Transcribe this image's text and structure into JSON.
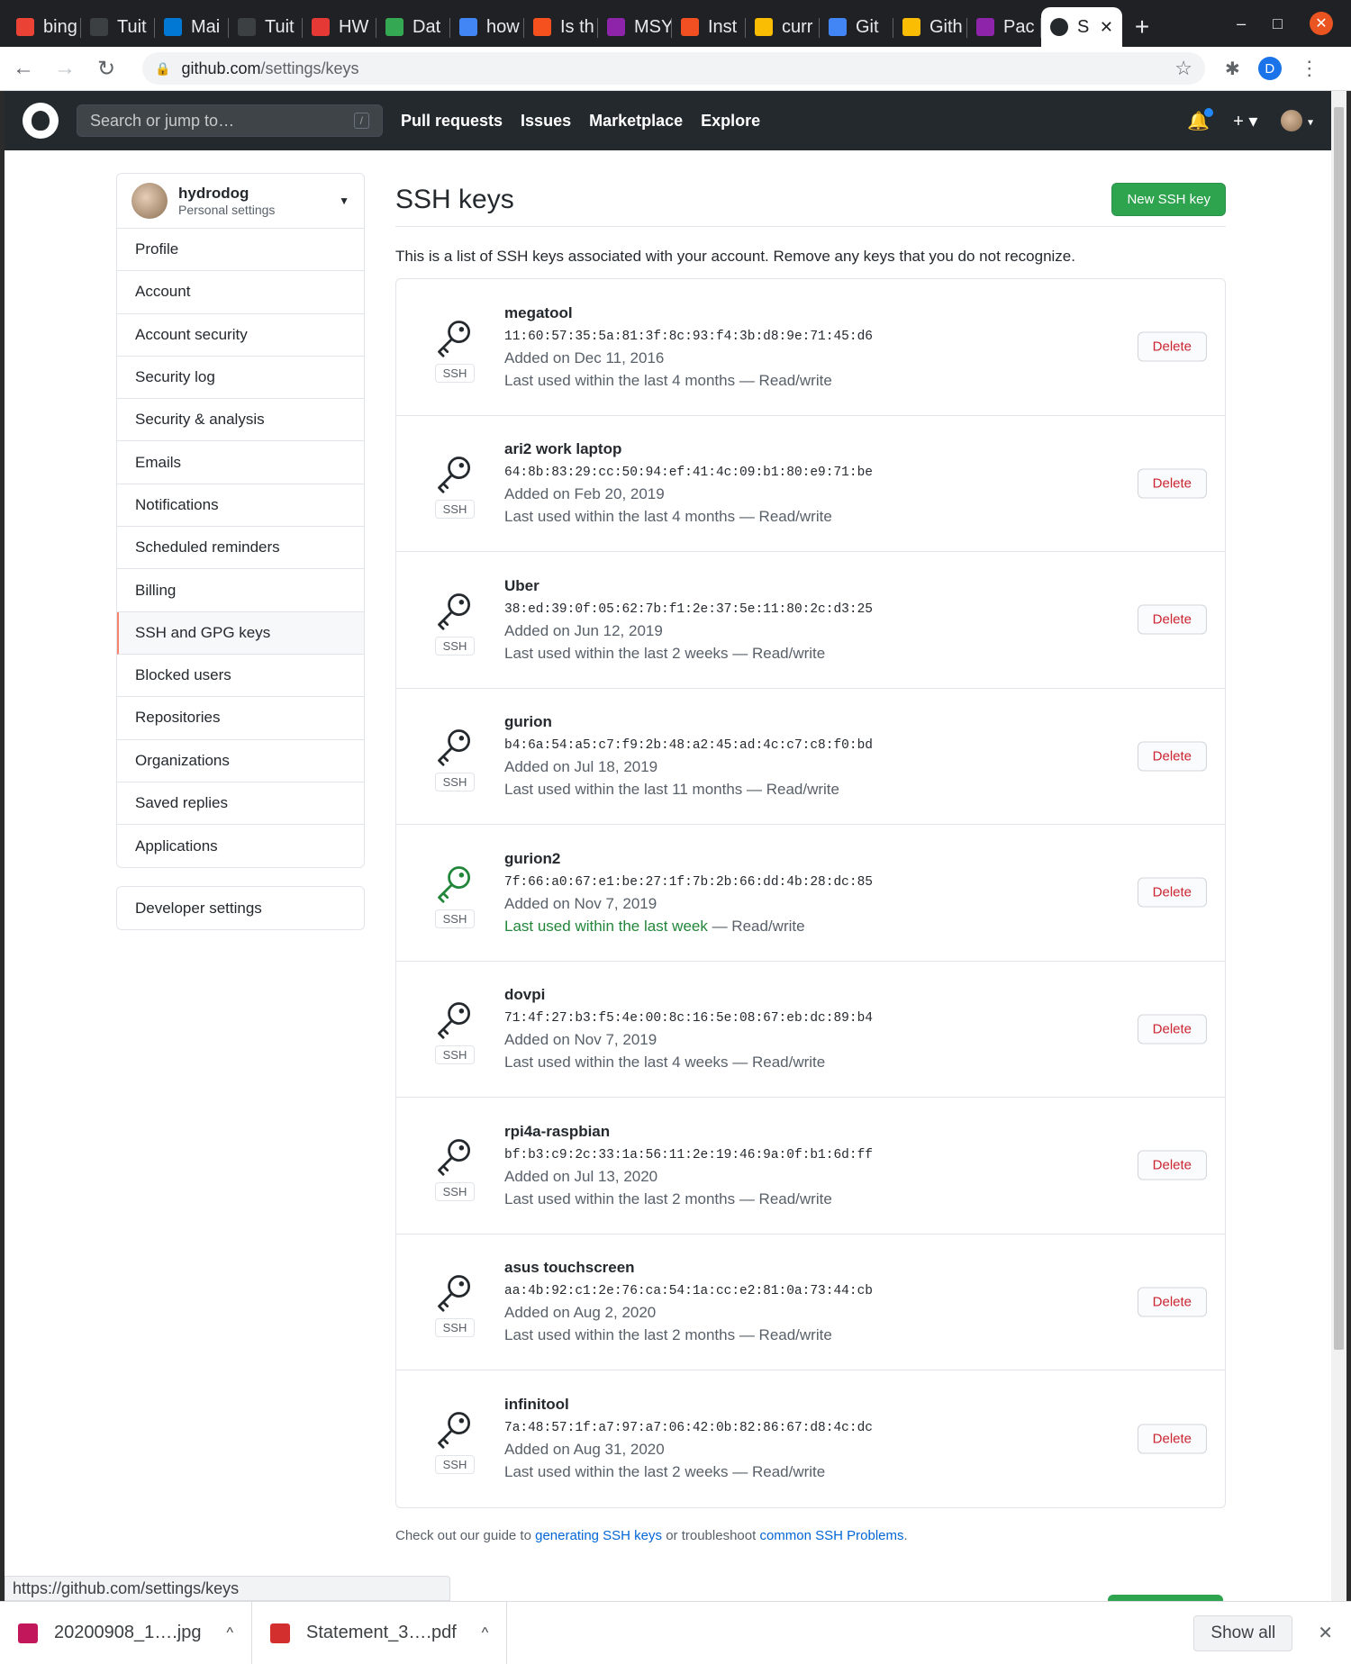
{
  "browser": {
    "tabs": [
      {
        "label": "bing",
        "color": "#ea4335"
      },
      {
        "label": "Tuit",
        "color": "#3c4043"
      },
      {
        "label": "Mai",
        "color": "#0078d4"
      },
      {
        "label": "Tuit",
        "color": "#3c4043"
      },
      {
        "label": "HW",
        "color": "#e53935"
      },
      {
        "label": "Dat",
        "color": "#34a853"
      },
      {
        "label": "how",
        "color": "#4285f4"
      },
      {
        "label": "Is th",
        "color": "#f4511e"
      },
      {
        "label": "MSY",
        "color": "#8e24aa"
      },
      {
        "label": "Inst",
        "color": "#f25022"
      },
      {
        "label": "curr",
        "color": "#fbbc04"
      },
      {
        "label": "Git",
        "color": "#4285f4"
      },
      {
        "label": "Gith",
        "color": "#fbbc04"
      },
      {
        "label": "Pac",
        "color": "#8e24aa"
      }
    ],
    "active_tab": {
      "label": "S",
      "close": "✕"
    },
    "new_tab": "+",
    "window": {
      "minimize": "–",
      "maximize": "□",
      "close": "✕"
    },
    "url_host": "github.com",
    "url_path": "/settings/keys",
    "profile_initial": "D",
    "status_url": "https://github.com/settings/keys"
  },
  "header": {
    "search_placeholder": "Search or jump to…",
    "search_shortcut": "/",
    "nav": [
      "Pull requests",
      "Issues",
      "Marketplace",
      "Explore"
    ],
    "plus": "+ ▾",
    "avatar_caret": "▾"
  },
  "sidebar": {
    "username": "hydrodog",
    "subtitle": "Personal settings",
    "items": [
      {
        "label": "Profile"
      },
      {
        "label": "Account"
      },
      {
        "label": "Account security"
      },
      {
        "label": "Security log"
      },
      {
        "label": "Security & analysis"
      },
      {
        "label": "Emails"
      },
      {
        "label": "Notifications"
      },
      {
        "label": "Scheduled reminders"
      },
      {
        "label": "Billing"
      },
      {
        "label": "SSH and GPG keys"
      },
      {
        "label": "Blocked users"
      },
      {
        "label": "Repositories"
      },
      {
        "label": "Organizations"
      },
      {
        "label": "Saved replies"
      },
      {
        "label": "Applications"
      }
    ],
    "developer_settings": "Developer settings"
  },
  "main": {
    "title": "SSH keys",
    "new_button": "New SSH key",
    "intro": "This is a list of SSH keys associated with your account. Remove any keys that you do not recognize.",
    "badge": "SSH",
    "delete_label": "Delete",
    "keys": [
      {
        "title": "megatool",
        "fingerprint": "11:60:57:35:5a:81:3f:8c:93:f4:3b:d8:9e:71:45:d6",
        "added": "Added on Dec 11, 2016",
        "used": "Last used within the last 4 months",
        "access": " — Read/write",
        "recent": false
      },
      {
        "title": "ari2 work laptop",
        "fingerprint": "64:8b:83:29:cc:50:94:ef:41:4c:09:b1:80:e9:71:be",
        "added": "Added on Feb 20, 2019",
        "used": "Last used within the last 4 months",
        "access": " — Read/write",
        "recent": false
      },
      {
        "title": "Uber",
        "fingerprint": "38:ed:39:0f:05:62:7b:f1:2e:37:5e:11:80:2c:d3:25",
        "added": "Added on Jun 12, 2019",
        "used": "Last used within the last 2 weeks",
        "access": " — Read/write",
        "recent": false
      },
      {
        "title": "gurion",
        "fingerprint": "b4:6a:54:a5:c7:f9:2b:48:a2:45:ad:4c:c7:c8:f0:bd",
        "added": "Added on Jul 18, 2019",
        "used": "Last used within the last 11 months",
        "access": " — Read/write",
        "recent": false
      },
      {
        "title": "gurion2",
        "fingerprint": "7f:66:a0:67:e1:be:27:1f:7b:2b:66:dd:4b:28:dc:85",
        "added": "Added on Nov 7, 2019",
        "used": "Last used within the last week",
        "access": " — Read/write",
        "recent": true
      },
      {
        "title": "dovpi",
        "fingerprint": "71:4f:27:b3:f5:4e:00:8c:16:5e:08:67:eb:dc:89:b4",
        "added": "Added on Nov 7, 2019",
        "used": "Last used within the last 4 weeks",
        "access": " — Read/write",
        "recent": false
      },
      {
        "title": "rpi4a-raspbian",
        "fingerprint": "bf:b3:c9:2c:33:1a:56:11:2e:19:46:9a:0f:b1:6d:ff",
        "added": "Added on Jul 13, 2020",
        "used": "Last used within the last 2 months",
        "access": " — Read/write",
        "recent": false
      },
      {
        "title": "asus touchscreen",
        "fingerprint": "aa:4b:92:c1:2e:76:ca:54:1a:cc:e2:81:0a:73:44:cb",
        "added": "Added on Aug 2, 2020",
        "used": "Last used within the last 2 months",
        "access": " — Read/write",
        "recent": false
      },
      {
        "title": "infinitool",
        "fingerprint": "7a:48:57:1f:a7:97:a7:06:42:0b:82:86:67:d8:4c:dc",
        "added": "Added on Aug 31, 2020",
        "used": "Last used within the last 2 weeks",
        "access": " — Read/write",
        "recent": false
      }
    ],
    "footnote": {
      "prefix": "Check out our guide to ",
      "link1": "generating SSH keys",
      "middle": " or troubleshoot ",
      "link2": "common SSH Problems",
      "suffix": "."
    }
  },
  "downloads": {
    "items": [
      {
        "name": "20200908_1….jpg",
        "color": "#c2185b"
      },
      {
        "name": "Statement_3….pdf",
        "color": "#d32f2f"
      }
    ],
    "show_all": "Show all",
    "close": "✕"
  },
  "colors": {
    "recent_green": "#22863a",
    "primary_green": "#2ea44f",
    "danger_red": "#cb2431"
  }
}
